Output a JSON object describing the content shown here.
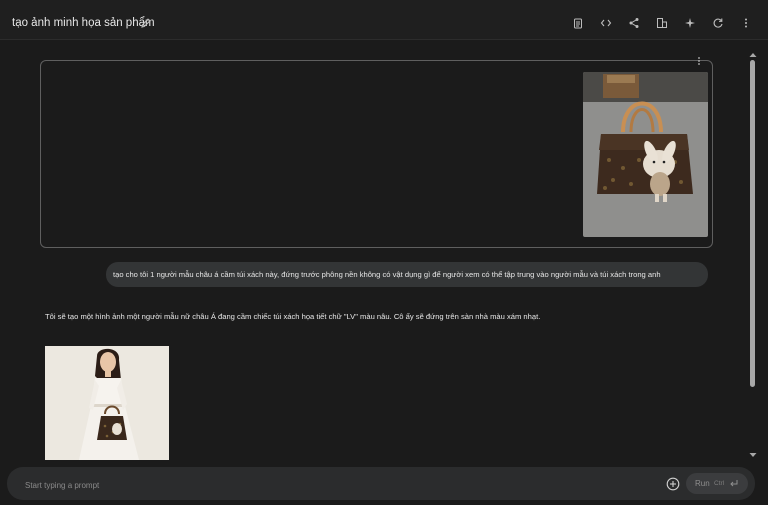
{
  "header": {
    "title": "tạo ảnh minh họa sản phẩm",
    "icons": [
      "edit-icon",
      "clipboard-icon",
      "code-icon",
      "share-icon",
      "compare-icon",
      "sparkle-icon",
      "refresh-icon",
      "more-vert-icon"
    ]
  },
  "chat": {
    "uploaded_image_alt": "brown monogram handbag with plush bunny charm",
    "user_message": "tạo cho tôi 1 người mẫu châu á cầm túi xách này, đứng trước phông nền không có vật dụng gì để người xem có thể tập trung vào người mẫu và túi xách trong anh",
    "model_message": "Tôi sẽ tạo một hình ảnh một người mẫu nữ châu Á đang cầm chiếc túi xách họa tiết chữ \"LV\" màu nâu. Cô ấy sẽ đứng trên sàn nhà màu xám nhạt.",
    "generated_image_alt": "Asian female model in white dress holding brown handbag"
  },
  "prompt": {
    "placeholder": "Start typing a prompt",
    "run_label": "Run",
    "run_shortcut": "Ctrl"
  },
  "colors": {
    "background": "#1b1b1b",
    "bubble": "#333536",
    "card_border": "#5f5f5f",
    "scroll_thumb": "#a8a8a8"
  }
}
